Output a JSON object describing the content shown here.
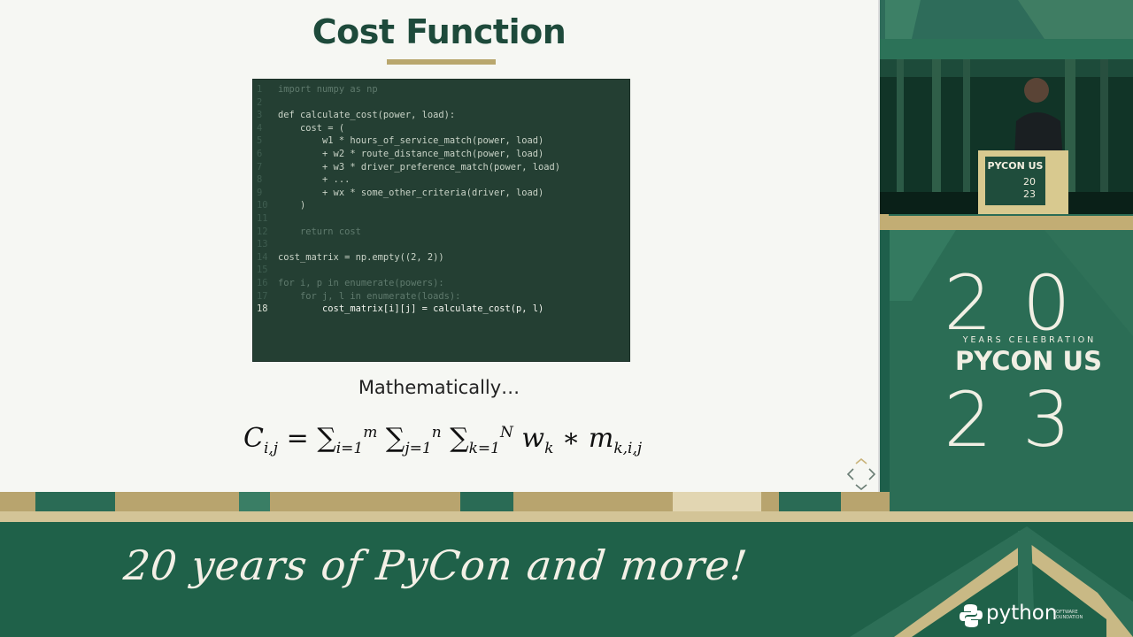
{
  "slide": {
    "title": "Cost Function",
    "code_lines": [
      {
        "num": "1",
        "text": "import numpy as np",
        "style": "dim"
      },
      {
        "num": "2",
        "text": "",
        "style": "dim"
      },
      {
        "num": "3",
        "text": "def calculate_cost(power, load):",
        "style": "normal"
      },
      {
        "num": "4",
        "text": "    cost = (",
        "style": "normal"
      },
      {
        "num": "5",
        "text": "        w1 * hours_of_service_match(power, load)",
        "style": "normal"
      },
      {
        "num": "6",
        "text": "        + w2 * route_distance_match(power, load)",
        "style": "normal"
      },
      {
        "num": "7",
        "text": "        + w3 * driver_preference_match(power, load)",
        "style": "normal"
      },
      {
        "num": "8",
        "text": "        + ...",
        "style": "normal"
      },
      {
        "num": "9",
        "text": "        + wx * some_other_criteria(driver, load)",
        "style": "normal"
      },
      {
        "num": "10",
        "text": "    )",
        "style": "normal"
      },
      {
        "num": "11",
        "text": "",
        "style": "dim"
      },
      {
        "num": "12",
        "text": "    return cost",
        "style": "dim"
      },
      {
        "num": "13",
        "text": "",
        "style": "dim"
      },
      {
        "num": "14",
        "text": "cost_matrix = np.empty((2, 2))",
        "style": "normal"
      },
      {
        "num": "15",
        "text": "",
        "style": "dim"
      },
      {
        "num": "16",
        "text": "for i, p in enumerate(powers):",
        "style": "dim"
      },
      {
        "num": "17",
        "text": "    for j, l in enumerate(loads):",
        "style": "dim"
      },
      {
        "num": "18",
        "text": "        cost_matrix[i][j] = calculate_cost(p, l)",
        "style": "hl"
      }
    ],
    "math_label": "Mathematically…",
    "formula": {
      "lhs": "C",
      "lhs_sub": "i,j",
      "equals": "=",
      "sums": [
        {
          "sub": "i=1",
          "sup": "m"
        },
        {
          "sub": "j=1",
          "sup": "n"
        },
        {
          "sub": "k=1",
          "sup": "N"
        }
      ],
      "w": "w",
      "w_sub": "k",
      "times": "∗",
      "m": "m",
      "m_sub": "k,i,j"
    }
  },
  "banner": {
    "tagline": "20 years of PyCon and more!"
  },
  "logo": {
    "top_digits": "20",
    "years": "YEARS CELEBRATION",
    "pycon": "PYCON US",
    "bottom_digits": "23"
  },
  "camera": {
    "podium_title": "PYCON US",
    "podium_year_top": "20",
    "podium_year_bottom": "23"
  },
  "footer": {
    "python": "python",
    "python_sub": "SOFTWARE FOUNDATION"
  },
  "colors": {
    "frame_green": "#1e5f4b",
    "gold": "#b9a76e",
    "slide_bg": "#f6f7f3",
    "code_bg": "#243f33"
  }
}
